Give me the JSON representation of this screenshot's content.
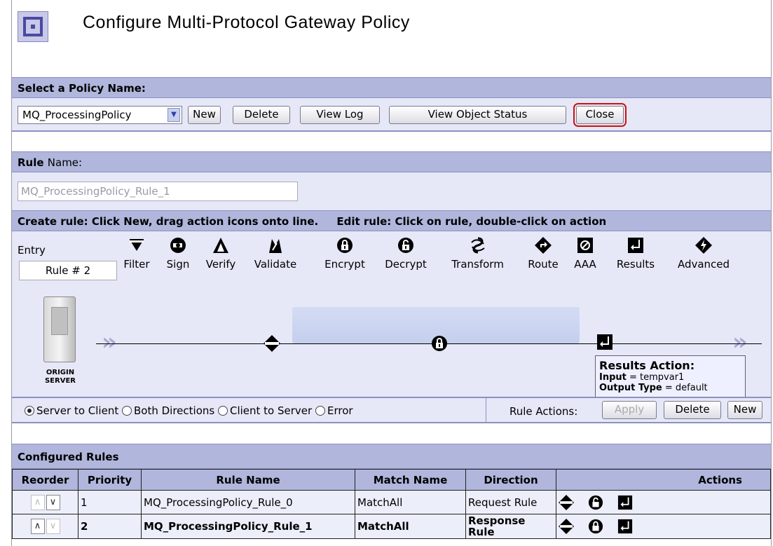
{
  "page": {
    "title": "Configure Multi-Protocol Gateway Policy"
  },
  "policy": {
    "header_bold": "Select a",
    "header_thin": "Policy",
    "header_bold2": "Name:",
    "selected": "MQ_ProcessingPolicy",
    "buttons": {
      "new": "New",
      "delete": "Delete",
      "view_log": "View Log",
      "view_status": "View Object Status",
      "close": "Close"
    }
  },
  "rule": {
    "header_bold": "Rule",
    "header_thin": "Name:",
    "name_value": "MQ_ProcessingPolicy_Rule_1",
    "create_text": "Create rule: Click New, drag action icons onto line.",
    "edit_text": "Edit rule: Click on rule, double-click on action",
    "entry_label": "Entry",
    "entry_value": "Rule # 2",
    "tools": [
      "Filter",
      "Sign",
      "Verify",
      "Validate",
      "Encrypt",
      "Decrypt",
      "Transform",
      "Route",
      "AAA",
      "Results",
      "Advanced"
    ],
    "tool_icons": [
      "filter-icon",
      "sign-icon",
      "verify-icon",
      "validate-icon",
      "encrypt-icon",
      "decrypt-icon",
      "transform-icon",
      "route-icon",
      "aaa-icon",
      "results-icon",
      "advanced-icon"
    ],
    "server_label_1": "ORIGIN",
    "server_label_2": "SERVER",
    "tooltip": {
      "title": "Results Action:",
      "input_label": "Input",
      "input_value": "= tempvar1",
      "output_label": "Output Type",
      "output_value": "= default"
    },
    "directions": [
      "Server to Client",
      "Both Directions",
      "Client to Server",
      "Error"
    ],
    "selected_direction": "Server to Client",
    "rule_actions_label": "Rule Actions:",
    "rule_action_buttons": {
      "apply": "Apply",
      "delete": "Delete",
      "new": "New"
    }
  },
  "configured": {
    "header": "Configured Rules",
    "columns": [
      "Reorder",
      "Priority",
      "Rule Name",
      "Match Name",
      "Direction",
      "Actions"
    ],
    "rows": [
      {
        "priority": "1",
        "name": "MQ_ProcessingPolicy_Rule_0",
        "match": "MatchAll",
        "direction": "Request Rule"
      },
      {
        "priority": "2",
        "name": "MQ_ProcessingPolicy_Rule_1",
        "match": "MatchAll",
        "direction": "Response Rule"
      }
    ]
  }
}
